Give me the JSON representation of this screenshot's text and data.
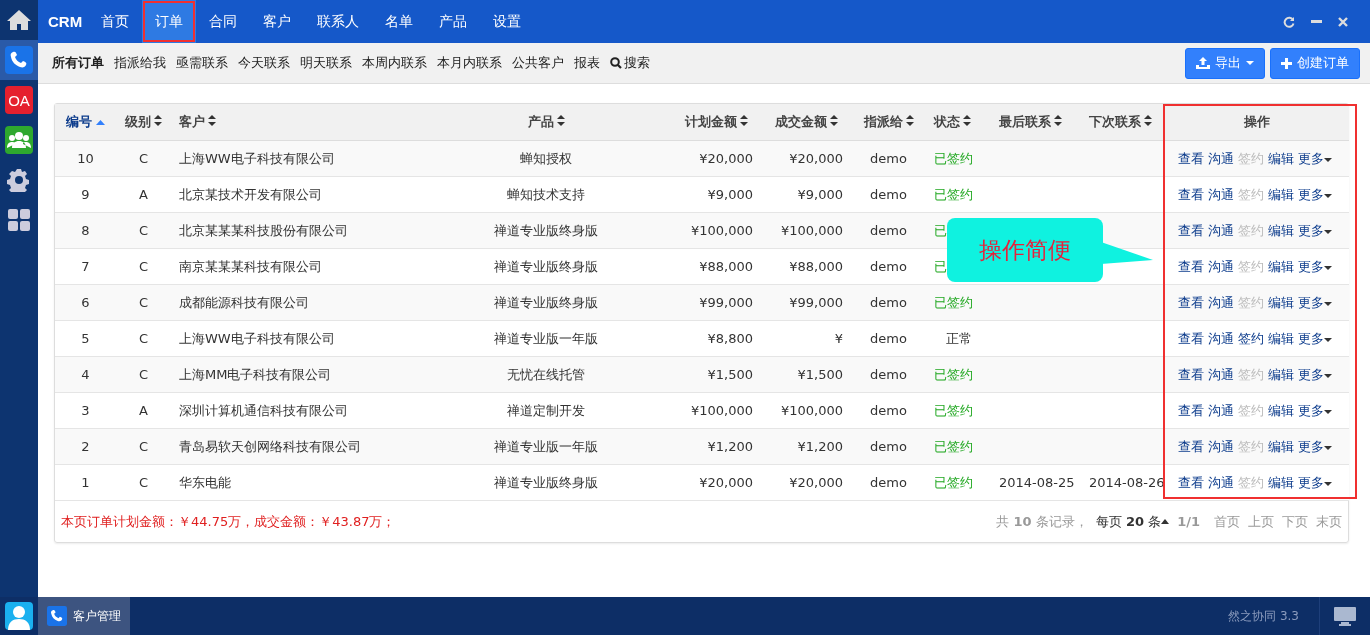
{
  "sidebar": {
    "apps": [
      {
        "kind": "home",
        "selected": false
      },
      {
        "kind": "phone",
        "selected": true
      },
      {
        "kind": "oa",
        "label": "OA",
        "selected": false
      },
      {
        "kind": "team",
        "selected": false
      },
      {
        "kind": "settings",
        "selected": false
      },
      {
        "kind": "apps",
        "selected": false
      }
    ]
  },
  "nav": {
    "brand": "CRM",
    "items": [
      {
        "label": "首页",
        "selected": false,
        "marked": false
      },
      {
        "label": "订单",
        "selected": true,
        "marked": true
      },
      {
        "label": "合同",
        "selected": false,
        "marked": false
      },
      {
        "label": "客户",
        "selected": false,
        "marked": false
      },
      {
        "label": "联系人",
        "selected": false,
        "marked": false
      },
      {
        "label": "名单",
        "selected": false,
        "marked": false
      },
      {
        "label": "产品",
        "selected": false,
        "marked": false
      },
      {
        "label": "设置",
        "selected": false,
        "marked": false
      }
    ]
  },
  "subnav": {
    "items": [
      {
        "label": "所有订单",
        "selected": true
      },
      {
        "label": "指派给我",
        "selected": false
      },
      {
        "label": "亟需联系",
        "selected": false
      },
      {
        "label": "今天联系",
        "selected": false
      },
      {
        "label": "明天联系",
        "selected": false
      },
      {
        "label": "本周内联系",
        "selected": false
      },
      {
        "label": "本月内联系",
        "selected": false
      },
      {
        "label": "公共客户",
        "selected": false
      },
      {
        "label": "报表",
        "selected": false
      }
    ],
    "search": "搜索",
    "export_button": "导出",
    "create_button": "创建订单"
  },
  "table": {
    "columns": [
      {
        "label": "编号",
        "sortable": true,
        "selected": true
      },
      {
        "label": "级别",
        "sortable": true,
        "selected": false
      },
      {
        "label": "客户",
        "sortable": true,
        "selected": false
      },
      {
        "label": "产品",
        "sortable": true,
        "selected": false
      },
      {
        "label": "计划金额",
        "sortable": true,
        "selected": false
      },
      {
        "label": "成交金额",
        "sortable": true,
        "selected": false
      },
      {
        "label": "指派给",
        "sortable": true,
        "selected": false
      },
      {
        "label": "状态",
        "sortable": true,
        "selected": false
      },
      {
        "label": "最后联系",
        "sortable": true,
        "selected": false
      },
      {
        "label": "下次联系",
        "sortable": true,
        "selected": false
      },
      {
        "label": "操作",
        "sortable": false,
        "selected": false
      }
    ],
    "rows": [
      {
        "id": "10",
        "level": "C",
        "customer": "上海WW电子科技有限公司",
        "product": "蝉知授权",
        "planned": "¥20,000",
        "closed": "¥20,000",
        "assignee": "demo",
        "status": {
          "text": "已签约",
          "kind": "signed"
        },
        "last_contact": "",
        "next_contact": "",
        "actions": [
          {
            "label": "查看",
            "disabled": false
          },
          {
            "label": "沟通",
            "disabled": false
          },
          {
            "label": "签约",
            "disabled": true
          },
          {
            "label": "编辑",
            "disabled": false
          }
        ],
        "more": "更多"
      },
      {
        "id": "9",
        "level": "A",
        "customer": "北京某技术开发有限公司",
        "product": "蝉知技术支持",
        "planned": "¥9,000",
        "closed": "¥9,000",
        "assignee": "demo",
        "status": {
          "text": "已签约",
          "kind": "signed"
        },
        "last_contact": "",
        "next_contact": "",
        "actions": [
          {
            "label": "查看",
            "disabled": false
          },
          {
            "label": "沟通",
            "disabled": false
          },
          {
            "label": "签约",
            "disabled": true
          },
          {
            "label": "编辑",
            "disabled": false
          }
        ],
        "more": "更多"
      },
      {
        "id": "8",
        "level": "C",
        "customer": "北京某某某科技股份有限公司",
        "product": "禅道专业版终身版",
        "planned": "¥100,000",
        "closed": "¥100,000",
        "assignee": "demo",
        "status": {
          "text": "已",
          "kind": "signed"
        },
        "last_contact": "",
        "next_contact": "",
        "actions": [
          {
            "label": "查看",
            "disabled": false
          },
          {
            "label": "沟通",
            "disabled": false
          },
          {
            "label": "签约",
            "disabled": true
          },
          {
            "label": "编辑",
            "disabled": false
          }
        ],
        "more": "更多"
      },
      {
        "id": "7",
        "level": "C",
        "customer": "南京某某某科技有限公司",
        "product": "禅道专业版终身版",
        "planned": "¥88,000",
        "closed": "¥88,000",
        "assignee": "demo",
        "status": {
          "text": "已",
          "kind": "signed"
        },
        "last_contact": "",
        "next_contact": "",
        "actions": [
          {
            "label": "查看",
            "disabled": false
          },
          {
            "label": "沟通",
            "disabled": false
          },
          {
            "label": "签约",
            "disabled": true
          },
          {
            "label": "编辑",
            "disabled": false
          }
        ],
        "more": "更多"
      },
      {
        "id": "6",
        "level": "C",
        "customer": "成都能源科技有限公司",
        "product": "禅道专业版终身版",
        "planned": "¥99,000",
        "closed": "¥99,000",
        "assignee": "demo",
        "status": {
          "text": "已签约",
          "kind": "signed"
        },
        "last_contact": "",
        "next_contact": "",
        "actions": [
          {
            "label": "查看",
            "disabled": false
          },
          {
            "label": "沟通",
            "disabled": false
          },
          {
            "label": "签约",
            "disabled": true
          },
          {
            "label": "编辑",
            "disabled": false
          }
        ],
        "more": "更多"
      },
      {
        "id": "5",
        "level": "C",
        "customer": "上海WW电子科技有限公司",
        "product": "禅道专业版一年版",
        "planned": "¥8,800",
        "closed": "¥",
        "assignee": "demo",
        "status": {
          "text": "正常",
          "kind": "normal"
        },
        "last_contact": "",
        "next_contact": "",
        "actions": [
          {
            "label": "查看",
            "disabled": false
          },
          {
            "label": "沟通",
            "disabled": false
          },
          {
            "label": "签约",
            "disabled": false
          },
          {
            "label": "编辑",
            "disabled": false
          }
        ],
        "more": "更多"
      },
      {
        "id": "4",
        "level": "C",
        "customer": "上海MM电子科技有限公司",
        "product": "无忧在线托管",
        "planned": "¥1,500",
        "closed": "¥1,500",
        "assignee": "demo",
        "status": {
          "text": "已签约",
          "kind": "signed"
        },
        "last_contact": "",
        "next_contact": "",
        "actions": [
          {
            "label": "查看",
            "disabled": false
          },
          {
            "label": "沟通",
            "disabled": false
          },
          {
            "label": "签约",
            "disabled": true
          },
          {
            "label": "编辑",
            "disabled": false
          }
        ],
        "more": "更多"
      },
      {
        "id": "3",
        "level": "A",
        "customer": "深圳计算机通信科技有限公司",
        "product": "禅道定制开发",
        "planned": "¥100,000",
        "closed": "¥100,000",
        "assignee": "demo",
        "status": {
          "text": "已签约",
          "kind": "signed"
        },
        "last_contact": "",
        "next_contact": "",
        "actions": [
          {
            "label": "查看",
            "disabled": false
          },
          {
            "label": "沟通",
            "disabled": false
          },
          {
            "label": "签约",
            "disabled": true
          },
          {
            "label": "编辑",
            "disabled": false
          }
        ],
        "more": "更多"
      },
      {
        "id": "2",
        "level": "C",
        "customer": "青岛易软天创网络科技有限公司",
        "product": "禅道专业版一年版",
        "planned": "¥1,200",
        "closed": "¥1,200",
        "assignee": "demo",
        "status": {
          "text": "已签约",
          "kind": "signed"
        },
        "last_contact": "",
        "next_contact": "",
        "actions": [
          {
            "label": "查看",
            "disabled": false
          },
          {
            "label": "沟通",
            "disabled": false
          },
          {
            "label": "签约",
            "disabled": true
          },
          {
            "label": "编辑",
            "disabled": false
          }
        ],
        "more": "更多"
      },
      {
        "id": "1",
        "level": "C",
        "customer": "华东电能",
        "product": "禅道专业版终身版",
        "planned": "¥20,000",
        "closed": "¥20,000",
        "assignee": "demo",
        "status": {
          "text": "已签约",
          "kind": "signed"
        },
        "last_contact": "2014-08-25",
        "next_contact": "2014-08-26",
        "actions": [
          {
            "label": "查看",
            "disabled": false
          },
          {
            "label": "沟通",
            "disabled": false
          },
          {
            "label": "签约",
            "disabled": true
          },
          {
            "label": "编辑",
            "disabled": false
          }
        ],
        "more": "更多"
      }
    ]
  },
  "footer": {
    "summary": "本页订单计划金额：￥44.75万，成交金额：￥43.87万；",
    "total": "共 **10** 条记录，",
    "page_size": "每页 **20** 条",
    "page": "1/1",
    "links": [
      "首页",
      "上页",
      "下页",
      "末页"
    ]
  },
  "callout": {
    "text": "操作简便"
  },
  "taskbar": {
    "task": "客户管理",
    "version": "然之协同 3.3"
  }
}
